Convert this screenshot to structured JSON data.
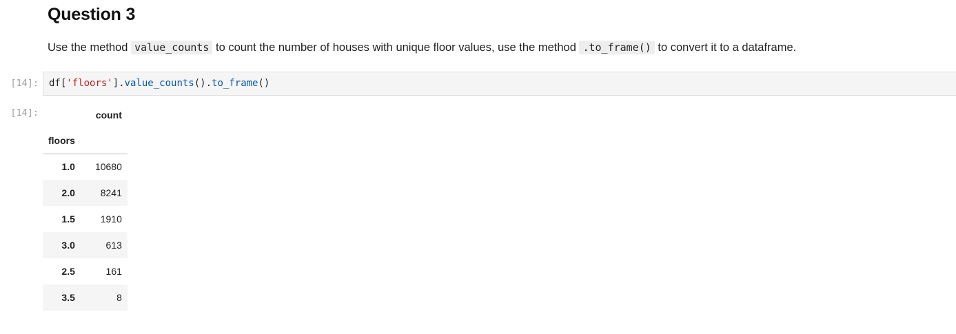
{
  "markdown": {
    "heading": "Question 3",
    "para_part1": "Use the method ",
    "code1": "value_counts",
    "para_part2": " to count the number of houses with unique floor values, use the method ",
    "code2": ".to_frame()",
    "para_part3": " to convert it to a dataframe."
  },
  "code_cell": {
    "in_prompt": "[14]:",
    "code_tokens": {
      "t1": "df[",
      "t2": "'floors'",
      "t3": "].",
      "t4": "value_counts",
      "t5": "().",
      "t6": "to_frame",
      "t7": "()"
    }
  },
  "output": {
    "out_prompt": "[14]:",
    "table": {
      "column_header": "count",
      "index_name": "floors",
      "rows": [
        {
          "index": "1.0",
          "count": "10680"
        },
        {
          "index": "2.0",
          "count": "8241"
        },
        {
          "index": "1.5",
          "count": "1910"
        },
        {
          "index": "3.0",
          "count": "613"
        },
        {
          "index": "2.5",
          "count": "161"
        },
        {
          "index": "3.5",
          "count": "8"
        }
      ]
    }
  }
}
